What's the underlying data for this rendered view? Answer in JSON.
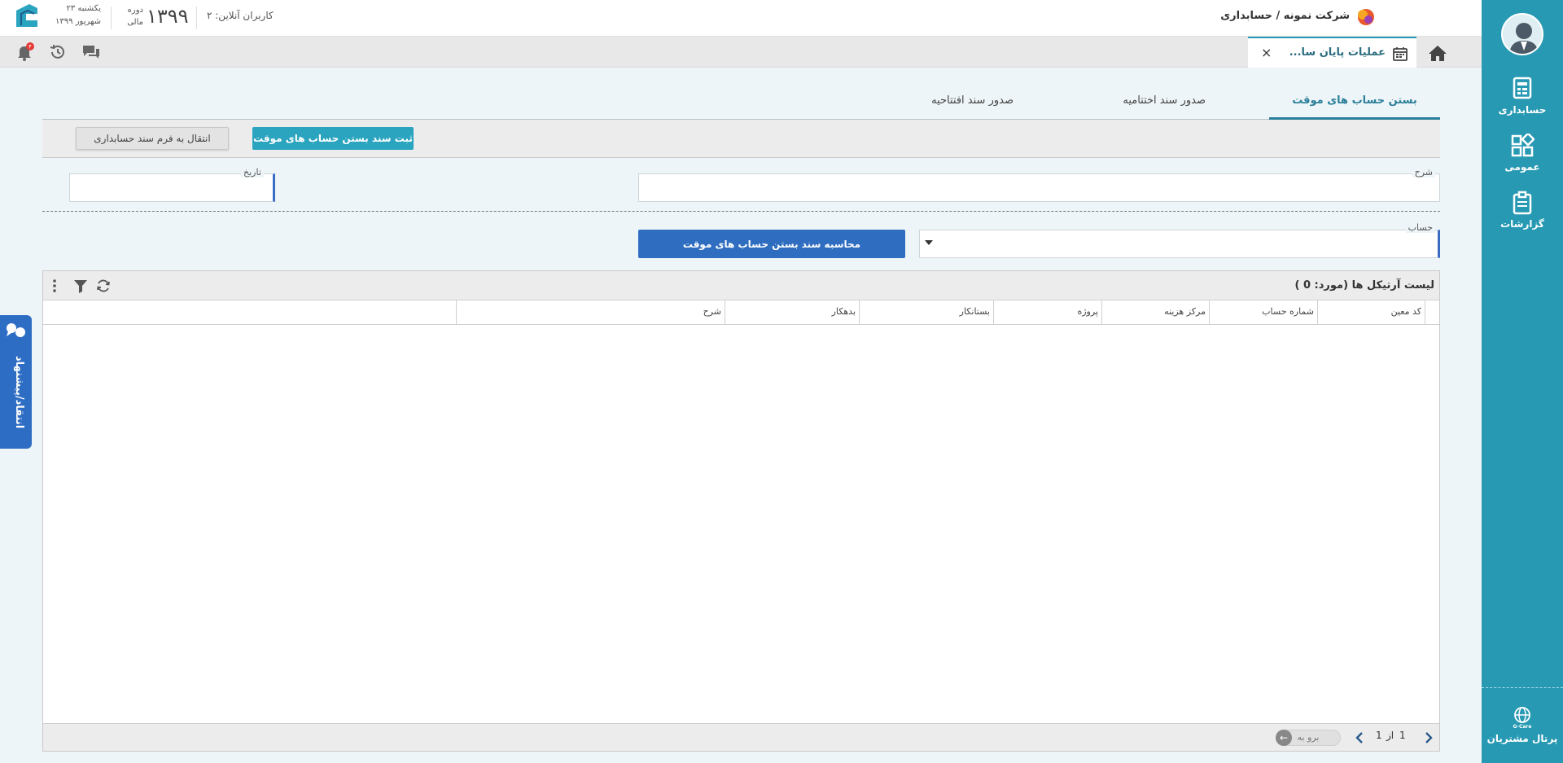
{
  "header": {
    "company_path": "شرکت نمونه / حسابداری",
    "online_users": "کاربران آنلاین: ۲",
    "period_year": "۱۳۹۹",
    "period_label_line1": "دوره",
    "period_label_line2": "مالی",
    "weekday": "یکشنبه ۲۳",
    "month_year": "شهریور ۱۳۹۹",
    "notification_count": "۴"
  },
  "sidebar": {
    "items": [
      {
        "label": "حسابداری",
        "icon": "accounting-icon"
      },
      {
        "label": "عمومی",
        "icon": "general-icon"
      },
      {
        "label": "گزارشات",
        "icon": "reports-icon"
      }
    ],
    "portal_label": "پرتال مشتریان",
    "portal_icon_text": "G-Care"
  },
  "tabbar": {
    "open_tab_title": "عملیات پایان سا...",
    "close_symbol": "×"
  },
  "page": {
    "tabs": [
      {
        "label": "بستن حساب های موقت",
        "active": true
      },
      {
        "label": "صدور سند اختتامیه",
        "active": false
      },
      {
        "label": "صدور سند افتتاحیه",
        "active": false
      }
    ],
    "toolbar": {
      "submit_label": "ثبت سند بستن حساب های موقت",
      "transfer_label": "انتقال به فرم سند حسابداری"
    },
    "form": {
      "description_label": "شرح",
      "description_value": "",
      "date_label": "تاریخ",
      "date_value": "",
      "account_label": "حساب",
      "account_value": ""
    },
    "calculate_label": "محاسبه سند بستن حساب های موقت"
  },
  "grid": {
    "title": "لیست آرتیکل ها (مورد:  0 )",
    "columns": [
      "کد معین",
      "شماره حساب",
      "مرکز هزینه",
      "پروژه",
      "بستانکار",
      "بدهکار",
      "شرح"
    ],
    "rows": [],
    "pager": {
      "current": "1",
      "of_label": "از",
      "total": "1",
      "goto_label": "برو به"
    }
  },
  "feedback": {
    "label": "انتقاد/پیشنهاد"
  },
  "colors": {
    "sidebar": "#2799b3",
    "primary_blue": "#2f6dc1",
    "teal_button": "#2aa4bf",
    "notification": "#e53935"
  }
}
